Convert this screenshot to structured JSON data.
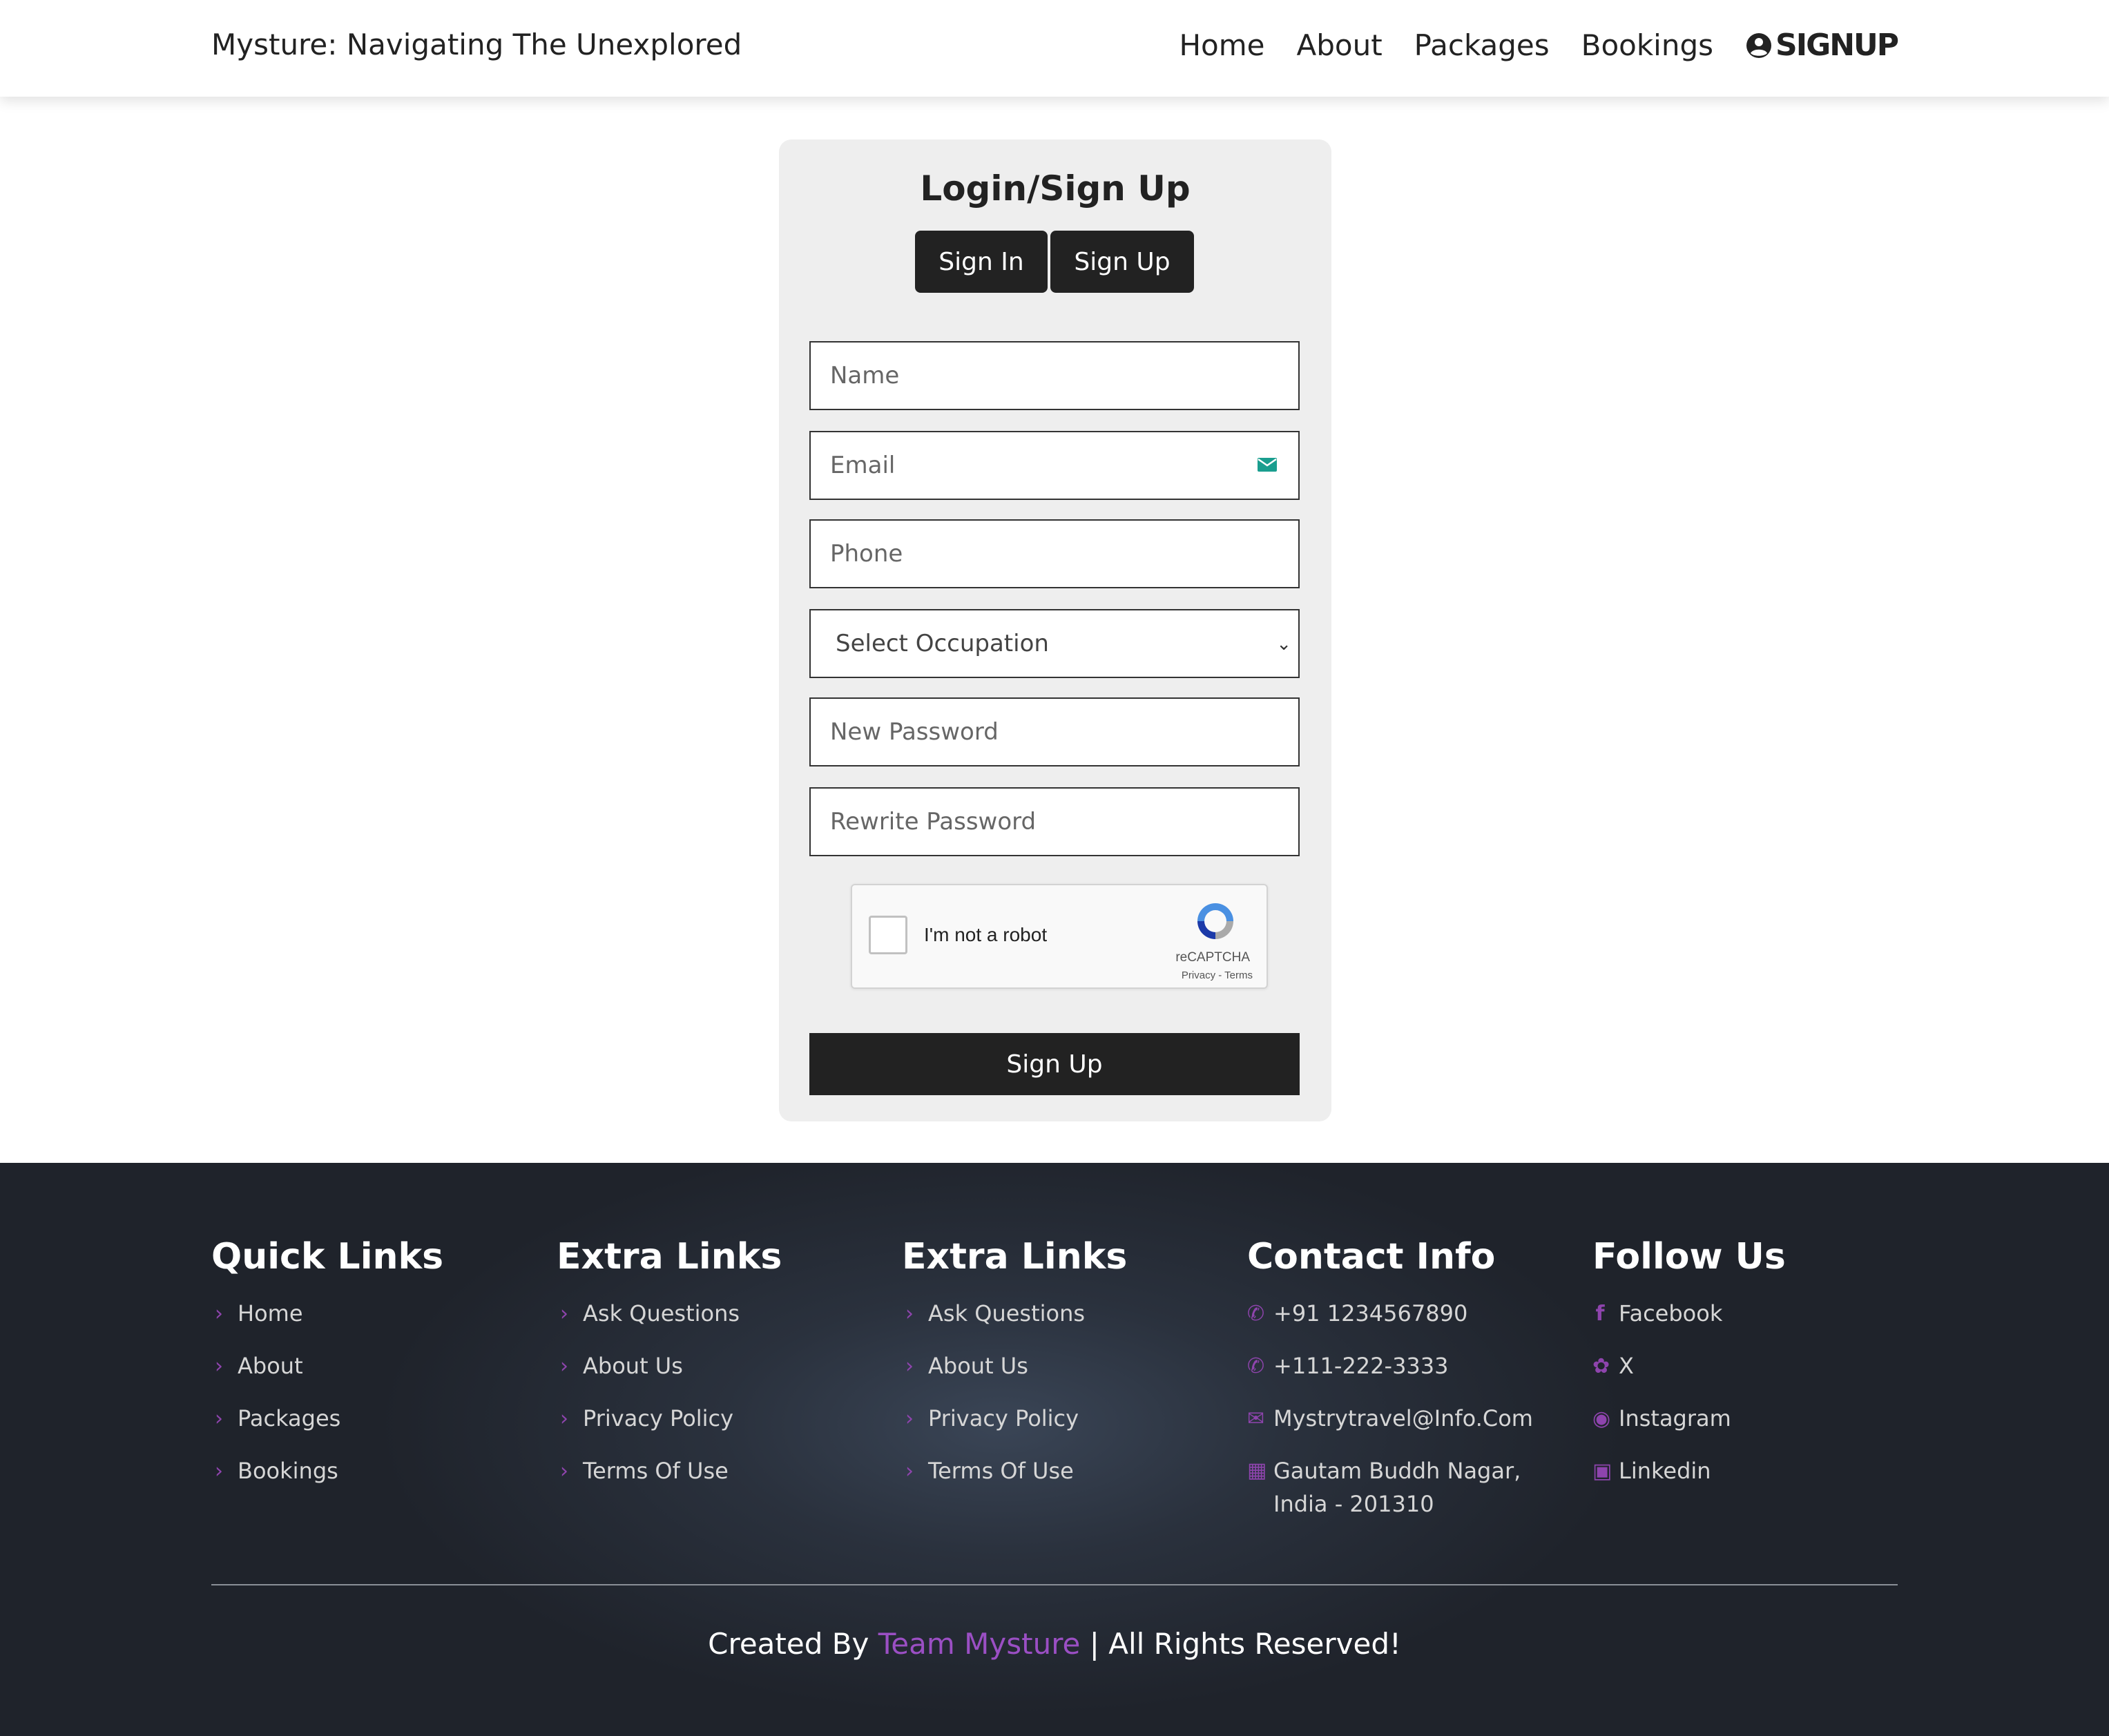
{
  "header": {
    "brand": "Mysture: Navigating The Unexplored",
    "nav": [
      "Home",
      "About",
      "Packages",
      "Bookings"
    ],
    "signup_label": "SIGNUP",
    "signup_icon": "user-circle-icon"
  },
  "form": {
    "title": "Login/Sign Up",
    "tab_sign_in": "Sign In",
    "tab_sign_up": "Sign Up",
    "name_placeholder": "Name",
    "email_placeholder": "Email",
    "phone_placeholder": "Phone",
    "occupation_selected": "Select Occupation",
    "new_password_placeholder": "New Password",
    "rewrite_password_placeholder": "Rewrite Password",
    "captcha": {
      "label": "I'm not a robot",
      "brand": "reCAPTCHA",
      "links": "Privacy - Terms"
    },
    "submit_label": "Sign Up"
  },
  "footer": {
    "quick_links": {
      "title": "Quick Links",
      "items": [
        "Home",
        "About",
        "Packages",
        "Bookings"
      ]
    },
    "extra_links_1": {
      "title": "Extra Links",
      "items": [
        "Ask Questions",
        "About Us",
        "Privacy Policy",
        "Terms Of Use"
      ]
    },
    "extra_links_2": {
      "title": "Extra Links",
      "items": [
        "Ask Questions",
        "About Us",
        "Privacy Policy",
        "Terms Of Use"
      ]
    },
    "contact": {
      "title": "Contact Info",
      "phone1": "+91 1234567890",
      "phone2": "+111-222-3333",
      "email": "Mystrytravel@Info.Com",
      "address": "Gautam Buddh Nagar, India - 201310"
    },
    "follow": {
      "title": "Follow Us",
      "items": [
        "Facebook",
        "X",
        "Instagram",
        "Linkedin"
      ]
    },
    "credit_prefix": "Created By",
    "credit_team": "Team Mysture",
    "credit_suffix": "| All Rights Reserved!",
    "accent_color": "#8e44ad"
  }
}
